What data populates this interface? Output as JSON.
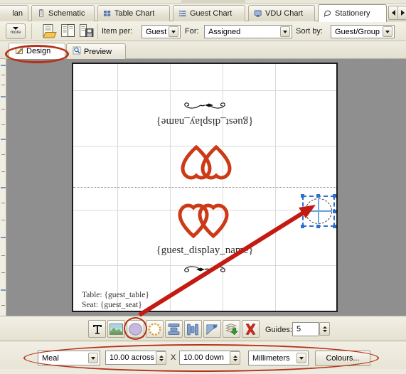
{
  "window": {
    "tabs": [
      {
        "label": "lan",
        "icon": "plan-icon",
        "active": false
      },
      {
        "label": "Schematic",
        "icon": "schematic-icon",
        "active": false
      },
      {
        "label": "Table Chart",
        "icon": "table-chart-icon",
        "active": false
      },
      {
        "label": "Guest Chart",
        "icon": "guest-chart-icon",
        "active": false
      },
      {
        "label": "VDU Chart",
        "icon": "vdu-chart-icon",
        "active": false
      },
      {
        "label": "Stationery",
        "icon": "stationery-icon",
        "active": true
      }
    ],
    "tab_scroll_left": "scroll-tabs-left",
    "tab_scroll_right": "scroll-tabs-right"
  },
  "toolbar": {
    "more_label": "more",
    "open_icon": "open-document-icon",
    "new_icon": "new-document-icon",
    "save_icon": "save-document-icon",
    "item_per_label": "Item per:",
    "item_per_value": "Guest",
    "for_label": "For:",
    "for_value": "Assigned",
    "sort_by_label": "Sort by:",
    "sort_by_value": "Guest/Group"
  },
  "subtabs": [
    {
      "label": "Design",
      "icon": "pencil-icon",
      "active": true
    },
    {
      "label": "Preview",
      "icon": "magnifier-icon",
      "active": false
    }
  ],
  "card": {
    "top_flourish": "flourish-ornament",
    "top_guest_field": "{guest_display_name}",
    "top_hearts": "double-hearts-icon",
    "bottom_hearts": "double-hearts-icon",
    "bottom_guest_field": "{guest_display_name}",
    "bottom_flourish": "flourish-ornament",
    "table_line": "Table: {guest_table}",
    "seat_line": "Seat: {guest_seat}",
    "selected_shape": "ellipse-shape-selected"
  },
  "shape_toolbar": {
    "buttons": [
      {
        "icon": "text-tool-icon",
        "name": "add-text-button"
      },
      {
        "icon": "picture-tool-icon",
        "name": "add-picture-button"
      },
      {
        "icon": "ellipse-tool-icon",
        "name": "add-ellipse-button"
      },
      {
        "icon": "polygon-tool-icon",
        "name": "add-polygon-button"
      },
      {
        "icon": "align-vertical-icon",
        "name": "align-vertical-button"
      },
      {
        "icon": "align-horizontal-icon",
        "name": "align-horizontal-button"
      },
      {
        "icon": "rotate-icon",
        "name": "rotate-button"
      },
      {
        "icon": "send-to-back-icon",
        "name": "send-to-back-button"
      },
      {
        "icon": "delete-icon",
        "name": "delete-shape-button"
      }
    ],
    "guides_label": "Guides:",
    "guides_value": "5"
  },
  "properties": {
    "item_type": "Meal",
    "across_value": "10.00 across",
    "x_label": "X",
    "down_value": "10.00 down",
    "units": "Millimeters",
    "colours_label": "Colours..."
  },
  "annotations": {
    "accent": "#b6321a",
    "arrow": "#c41a12",
    "highlight_design_tab": true,
    "highlight_ellipse_tool": true,
    "highlight_properties_bar": true,
    "arrow_from": "ellipse-tool-button",
    "arrow_to": "selected-ellipse-on-card"
  }
}
